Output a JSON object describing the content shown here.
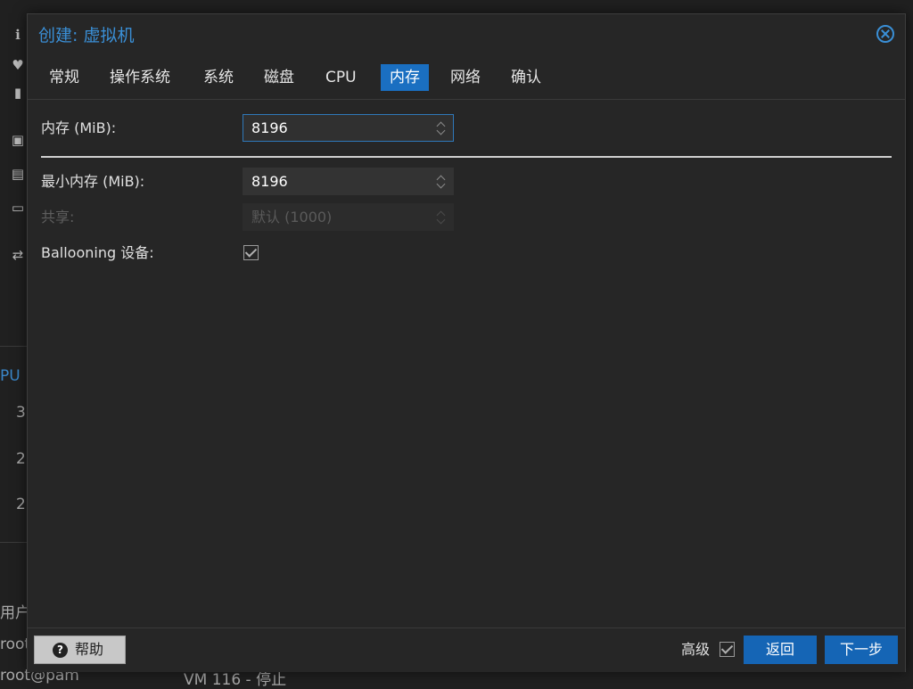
{
  "background": {
    "cpu_fragment": "PU",
    "rows": [
      "3",
      "2",
      "2"
    ],
    "user_fragment": "用户",
    "root_fragment": "root",
    "bottom_left": "root@pam",
    "bottom_status": "VM 116 - 停止"
  },
  "dialog": {
    "title": "创建: 虚拟机",
    "tabs": [
      {
        "label": "常规",
        "active": false
      },
      {
        "label": "操作系统",
        "active": false
      },
      {
        "label": "系统",
        "active": false
      },
      {
        "label": "磁盘",
        "active": false
      },
      {
        "label": "CPU",
        "active": false
      },
      {
        "label": "内存",
        "active": true
      },
      {
        "label": "网络",
        "active": false
      },
      {
        "label": "确认",
        "active": false
      }
    ],
    "form": {
      "memory_label": "内存 (MiB):",
      "memory_value": "8196",
      "min_memory_label": "最小内存 (MiB):",
      "min_memory_value": "8196",
      "shares_label": "共享:",
      "shares_placeholder": "默认 (1000)",
      "ballooning_label": "Ballooning 设备:",
      "ballooning_checked": true
    },
    "toolbar": {
      "help_label": "帮助",
      "advanced_label": "高级",
      "advanced_checked": true,
      "back_label": "返回",
      "next_label": "下一步"
    }
  },
  "colors": {
    "accent": "#1a6fc1",
    "title": "#3a8fd6",
    "window_bg": "#262626"
  }
}
